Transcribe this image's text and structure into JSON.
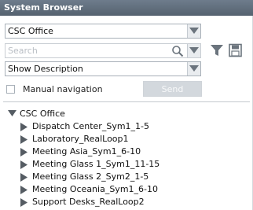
{
  "window": {
    "title": "System Browser"
  },
  "view_select": {
    "value": "CSC Office"
  },
  "search": {
    "placeholder": "Search"
  },
  "description_select": {
    "value": "Show Description"
  },
  "manual_nav": {
    "label": "Manual navigation",
    "checked": false
  },
  "send_button": {
    "label": "Send",
    "enabled": false
  },
  "tree": {
    "root": {
      "label": "CSC Office",
      "expanded": true
    },
    "children": [
      {
        "label": "Dispatch Center_Sym1_1-5"
      },
      {
        "label": "Laboratory_RealLoop1"
      },
      {
        "label": "Meeting Asia_Sym1_6-10"
      },
      {
        "label": "Meeting Glass 1_Sym1_11-15"
      },
      {
        "label": "Meeting Glass 2_Sym2_1-5"
      },
      {
        "label": "Meeting Oceania_Sym1_6-10"
      },
      {
        "label": "Support Desks_RealLoop2"
      }
    ]
  },
  "colors": {
    "titlebar": "#5d6a78",
    "icon": "#6b747d"
  }
}
